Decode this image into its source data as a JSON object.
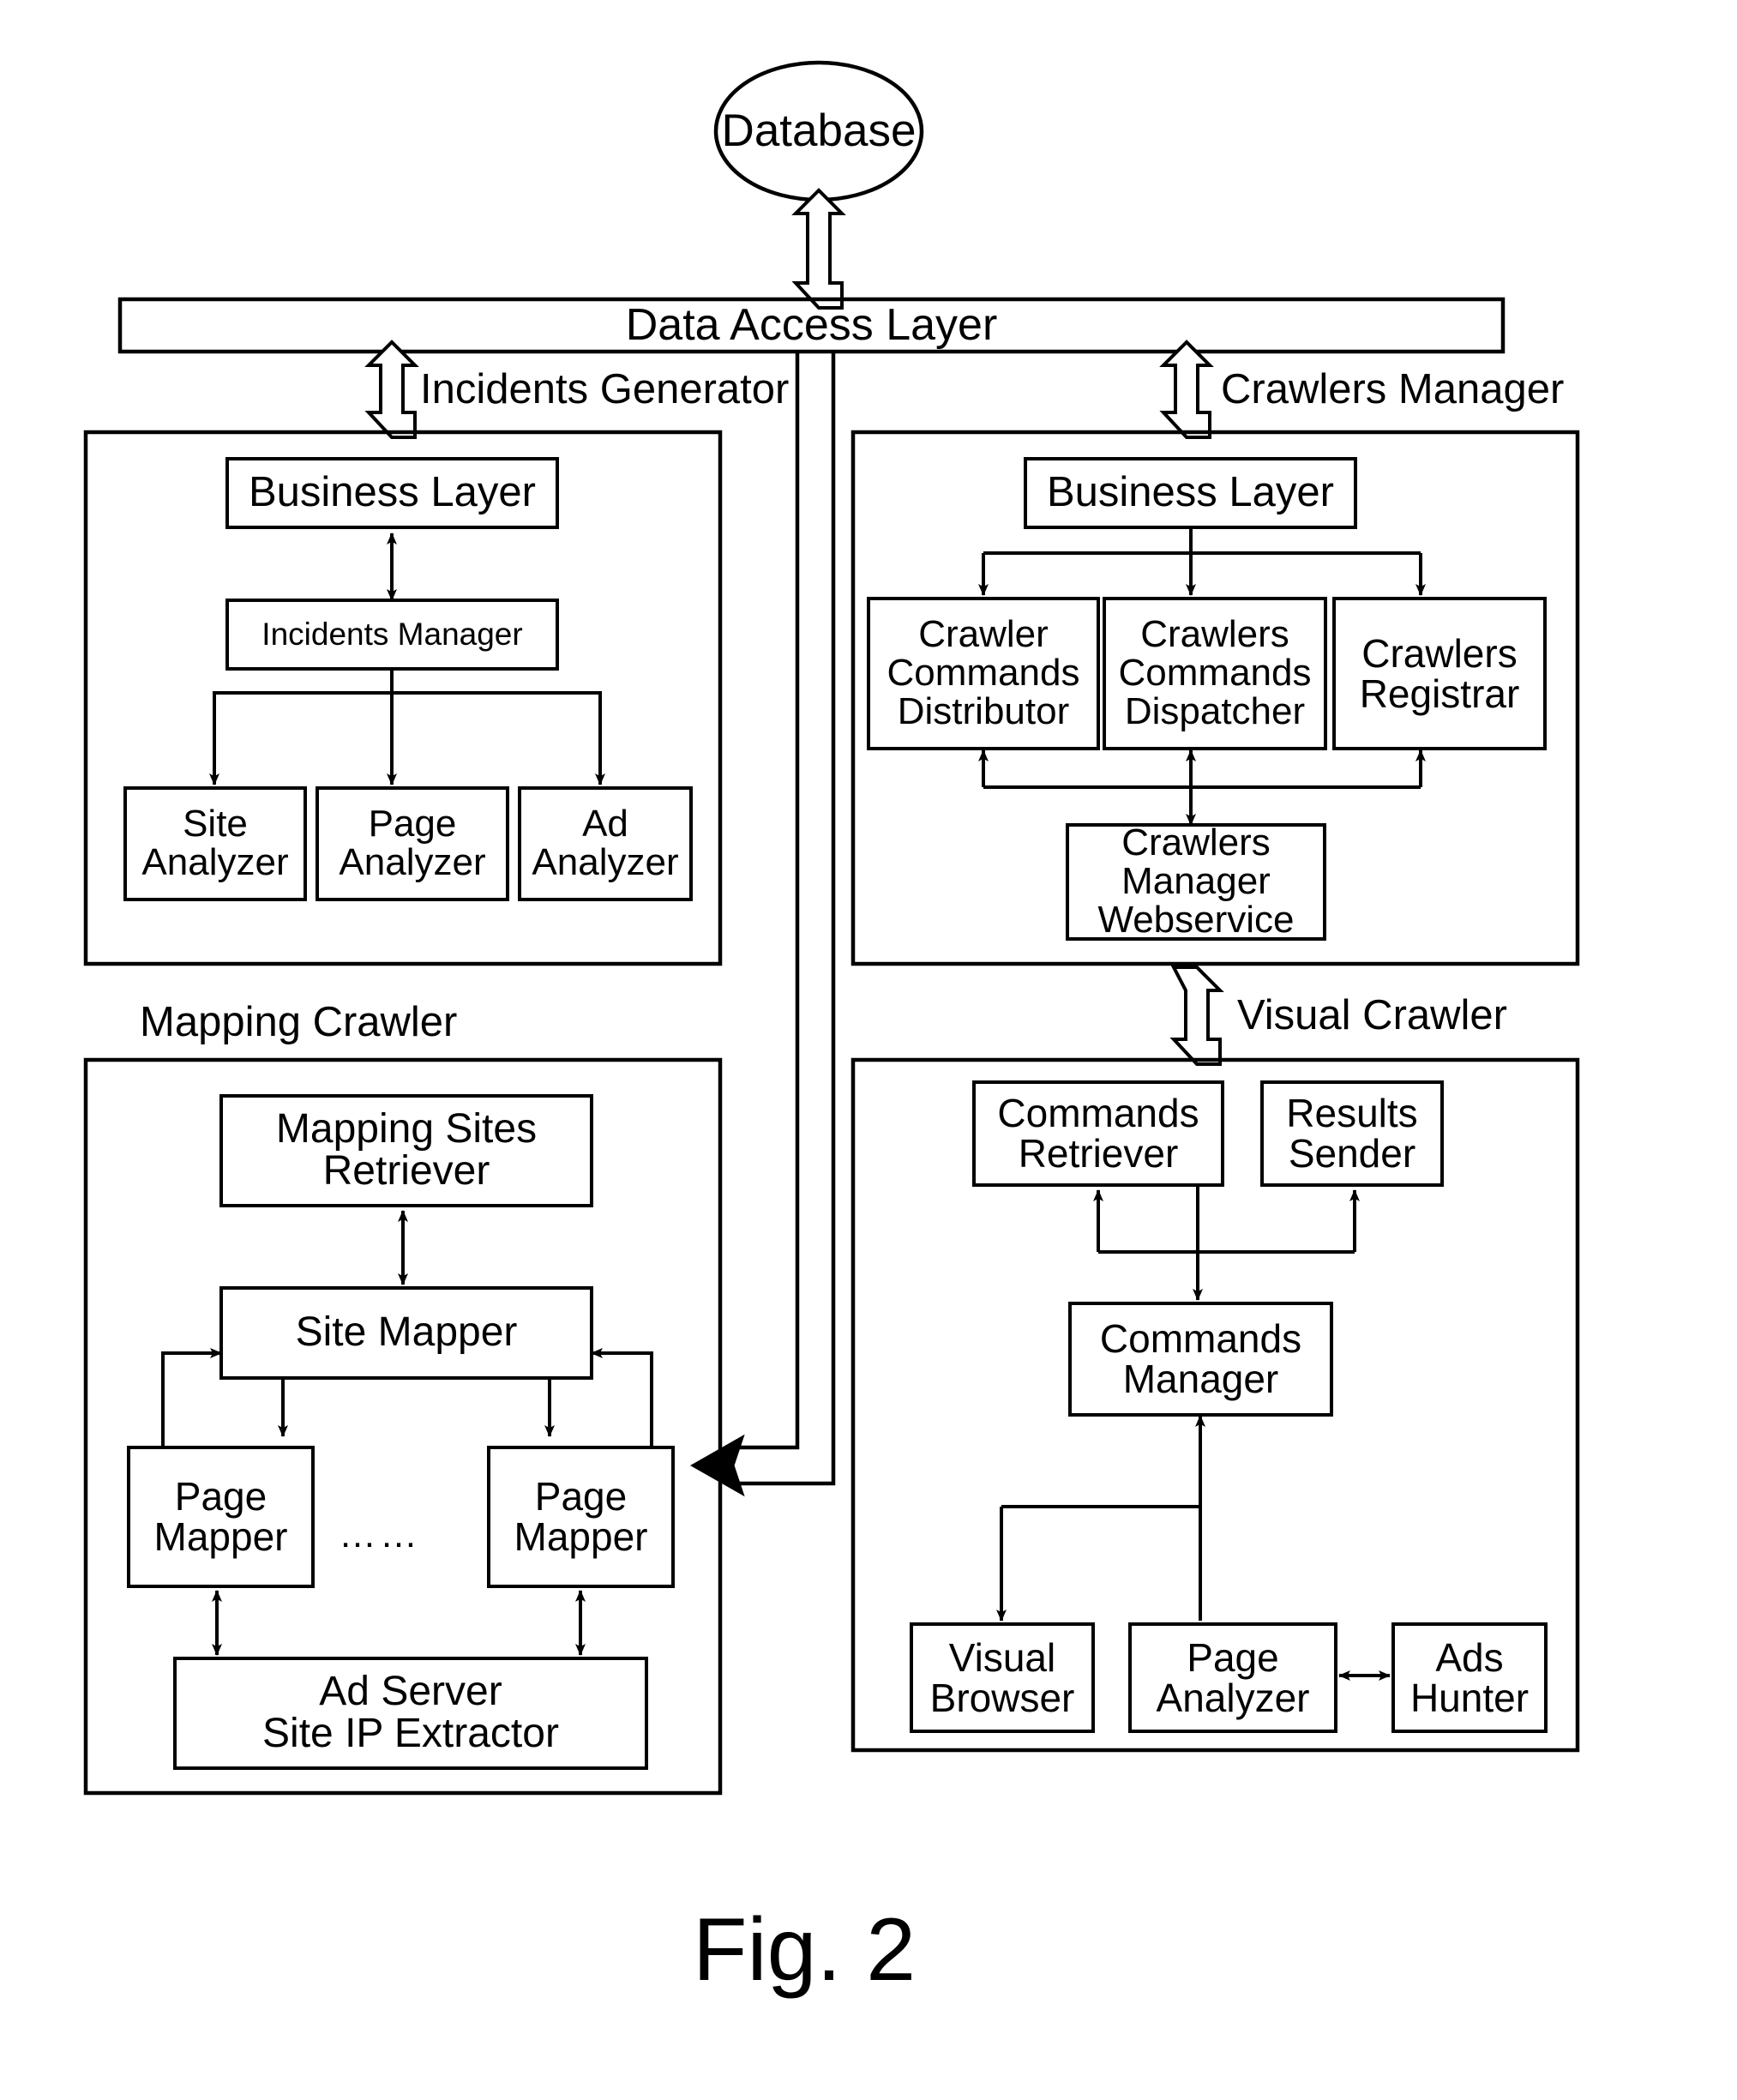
{
  "figure": {
    "caption": "Fig. 2",
    "database": {
      "label": "Database"
    },
    "data_access_layer": {
      "label": "Data Access Layer"
    },
    "connector_labels": {
      "incidents_generator": "Incidents Generator",
      "crawlers_manager": "Crawlers Manager",
      "mapping_crawler": "Mapping Crawler",
      "visual_crawler": "Visual Crawler"
    },
    "panels": [
      {
        "id": "incidents-generator",
        "title": "Incidents Generator",
        "nodes": [
          {
            "id": "ig-business-layer",
            "label": "Business Layer"
          },
          {
            "id": "ig-incidents-manager",
            "label": "Incidents Manager"
          },
          {
            "id": "ig-site-analyzer",
            "label": "Site\nAnalyzer"
          },
          {
            "id": "ig-page-analyzer",
            "label": "Page\nAnalyzer"
          },
          {
            "id": "ig-ad-analyzer",
            "label": "Ad\nAnalyzer"
          }
        ]
      },
      {
        "id": "crawlers-manager",
        "title": "Crawlers Manager",
        "nodes": [
          {
            "id": "cm-business-layer",
            "label": "Business Layer"
          },
          {
            "id": "cm-crawler-commands-distributor",
            "label": "Crawler\nCommands\nDistributor"
          },
          {
            "id": "cm-crawlers-commands-dispatcher",
            "label": "Crawlers\nCommands\nDispatcher"
          },
          {
            "id": "cm-crawlers-registrar",
            "label": "Crawlers\nRegistrar"
          },
          {
            "id": "cm-crawlers-manager-webservice",
            "label": "Crawlers\nManager\nWebservice"
          }
        ]
      },
      {
        "id": "mapping-crawler",
        "title": "Mapping Crawler",
        "nodes": [
          {
            "id": "mc-mapping-sites-retriever",
            "label": "Mapping Sites\nRetriever"
          },
          {
            "id": "mc-site-mapper",
            "label": "Site Mapper"
          },
          {
            "id": "mc-page-mapper-left",
            "label": "Page\nMapper"
          },
          {
            "id": "mc-page-mapper-right",
            "label": "Page\nMapper"
          },
          {
            "id": "mc-ellipsis",
            "label": "……"
          },
          {
            "id": "mc-ad-server-site-ip-extractor",
            "label": "Ad Server\nSite IP Extractor"
          }
        ]
      },
      {
        "id": "visual-crawler",
        "title": "Visual Crawler",
        "nodes": [
          {
            "id": "vc-commands-retriever",
            "label": "Commands\nRetriever"
          },
          {
            "id": "vc-results-sender",
            "label": "Results\nSender"
          },
          {
            "id": "vc-commands-manager",
            "label": "Commands\nManager"
          },
          {
            "id": "vc-visual-browser",
            "label": "Visual\nBrowser"
          },
          {
            "id": "vc-page-analyzer",
            "label": "Page\nAnalyzer"
          },
          {
            "id": "vc-ads-hunter",
            "label": "Ads\nHunter"
          }
        ]
      }
    ],
    "colors": {
      "stroke": "#000000",
      "background": "#ffffff"
    }
  }
}
